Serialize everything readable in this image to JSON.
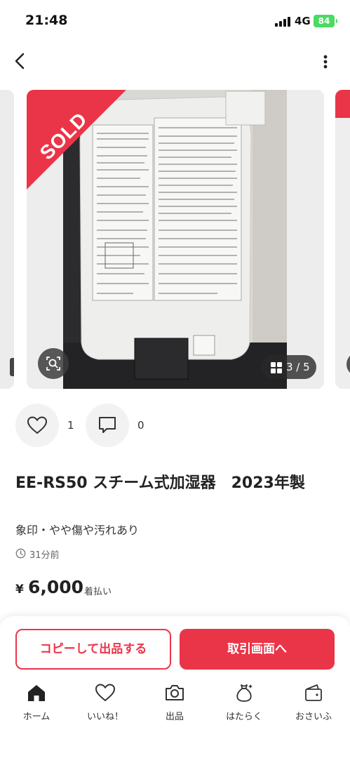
{
  "status_bar": {
    "time": "21:48",
    "network": "4G",
    "battery": "84"
  },
  "carousel": {
    "sold_label": "SOLD",
    "counter": "3 / 5"
  },
  "reactions": {
    "likes": "1",
    "comments": "0"
  },
  "product": {
    "title": "EE-RS50 スチーム式加湿器　2023年製",
    "subtitle": "象印・やや傷や汚れあり",
    "posted": "31分前",
    "currency_symbol": "¥",
    "price": "6,000",
    "price_note": "着払い"
  },
  "actions": {
    "copy_listing": "コピーして出品する",
    "transaction": "取引画面へ"
  },
  "tab_bar": [
    {
      "label": "ホーム",
      "icon": "home-icon"
    },
    {
      "label": "いいね！",
      "icon": "heart-icon"
    },
    {
      "label": "出品",
      "icon": "camera-icon"
    },
    {
      "label": "はたらく",
      "icon": "money-bag-icon"
    },
    {
      "label": "おさいふ",
      "icon": "wallet-icon"
    }
  ],
  "colors": {
    "accent": "#ea3548",
    "battery": "#4cd964"
  }
}
